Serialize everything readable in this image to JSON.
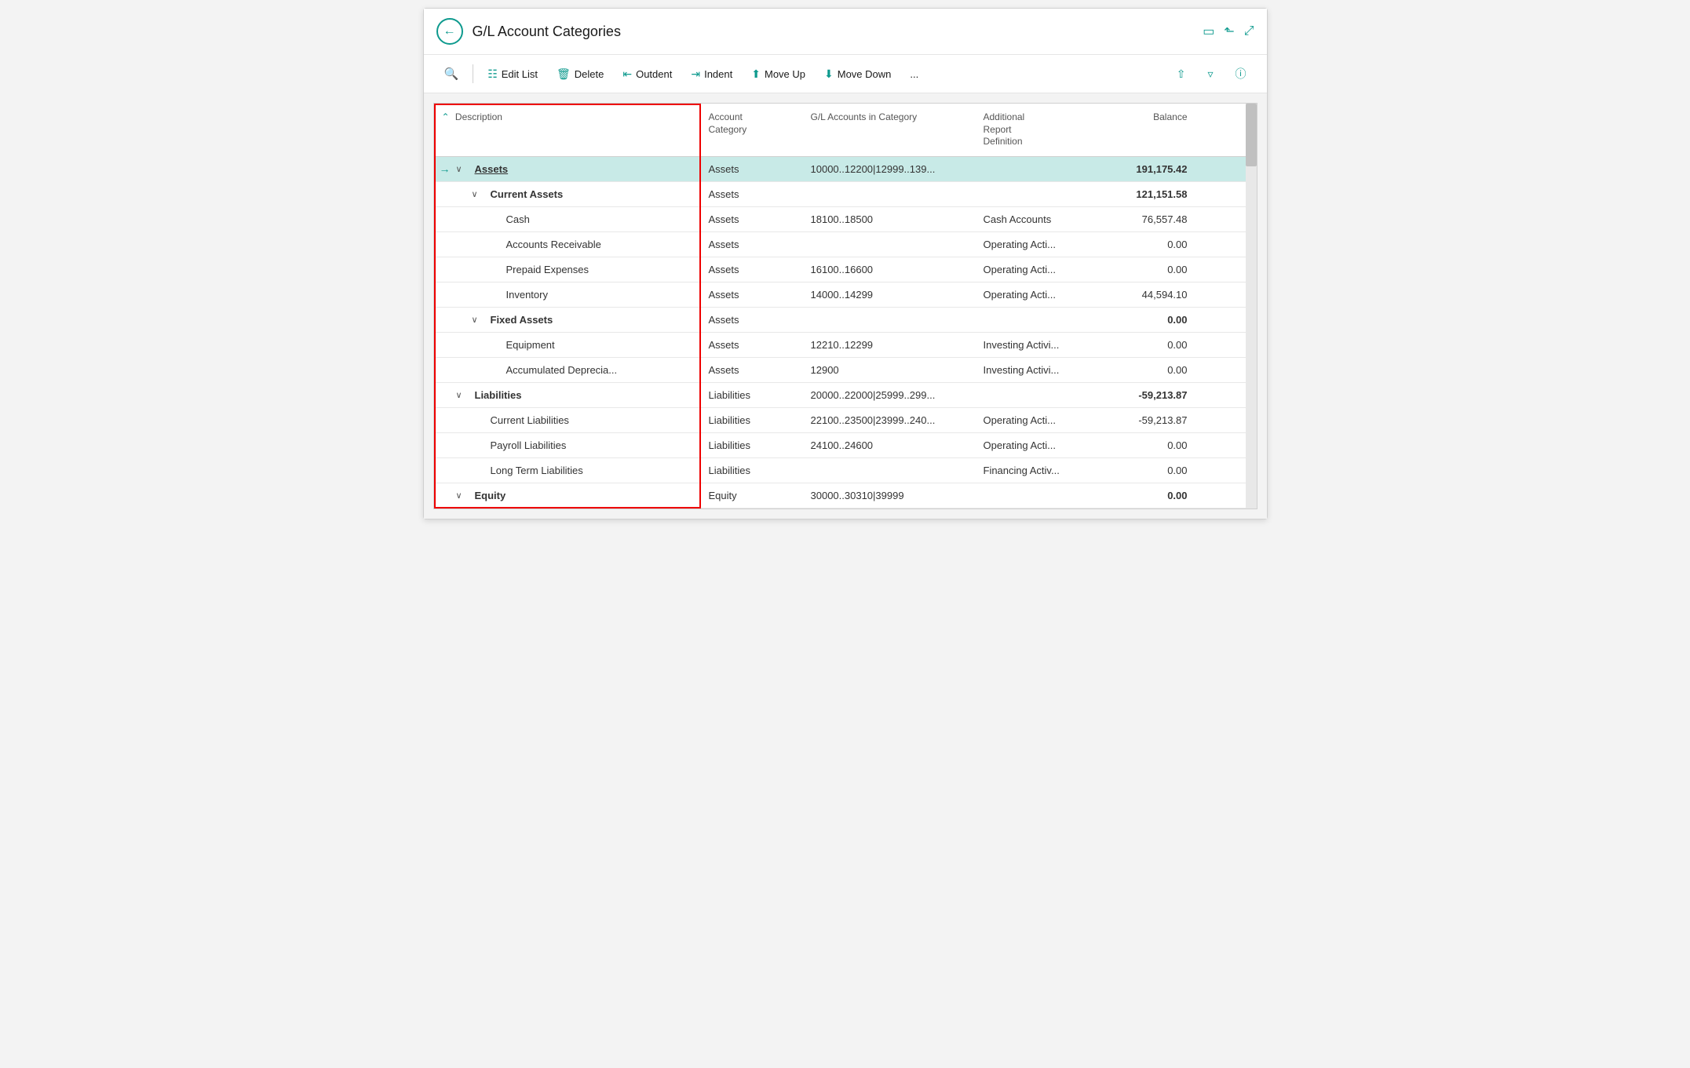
{
  "window": {
    "title": "G/L Account Categories"
  },
  "toolbar": {
    "search_placeholder": "Search",
    "edit_list": "Edit List",
    "delete": "Delete",
    "outdent": "Outdent",
    "indent": "Indent",
    "move_up": "Move Up",
    "move_down": "Move Down",
    "more": "...",
    "share_icon": "↑",
    "filter_icon": "⊿",
    "info_icon": "ⓘ"
  },
  "table": {
    "columns": [
      {
        "label": "Description"
      },
      {
        "label": "Account\nCategory"
      },
      {
        "label": "G/L Accounts in Category"
      },
      {
        "label": "Additional\nReport\nDefinition"
      },
      {
        "label": "Balance",
        "align": "right"
      }
    ],
    "rows": [
      {
        "indent": 0,
        "has_chevron": true,
        "chevron_dir": "down",
        "description": "Assets",
        "desc_bold": true,
        "desc_underline": true,
        "has_drag": true,
        "account_category": "Assets",
        "gl_accounts": "10000..12200|12999..139...",
        "add_report": "",
        "balance": "191,175.42",
        "balance_bold": true,
        "selected": true,
        "has_arrow": true
      },
      {
        "indent": 1,
        "has_chevron": true,
        "chevron_dir": "down",
        "description": "Current Assets",
        "desc_bold": true,
        "account_category": "Assets",
        "gl_accounts": "",
        "add_report": "",
        "balance": "121,151.58",
        "balance_bold": true,
        "selected": false
      },
      {
        "indent": 2,
        "has_chevron": false,
        "description": "Cash",
        "desc_bold": false,
        "account_category": "Assets",
        "gl_accounts": "18100..18500",
        "add_report": "Cash Accounts",
        "balance": "76,557.48",
        "balance_bold": false,
        "selected": false
      },
      {
        "indent": 2,
        "has_chevron": false,
        "description": "Accounts Receivable",
        "desc_bold": false,
        "account_category": "Assets",
        "gl_accounts": "",
        "add_report": "Operating Acti...",
        "balance": "0.00",
        "balance_bold": false,
        "selected": false
      },
      {
        "indent": 2,
        "has_chevron": false,
        "description": "Prepaid Expenses",
        "desc_bold": false,
        "account_category": "Assets",
        "gl_accounts": "16100..16600",
        "add_report": "Operating Acti...",
        "balance": "0.00",
        "balance_bold": false,
        "selected": false
      },
      {
        "indent": 2,
        "has_chevron": false,
        "description": "Inventory",
        "desc_bold": false,
        "account_category": "Assets",
        "gl_accounts": "14000..14299",
        "add_report": "Operating Acti...",
        "balance": "44,594.10",
        "balance_bold": false,
        "selected": false
      },
      {
        "indent": 1,
        "has_chevron": true,
        "chevron_dir": "down",
        "description": "Fixed Assets",
        "desc_bold": true,
        "account_category": "Assets",
        "gl_accounts": "",
        "add_report": "",
        "balance": "0.00",
        "balance_bold": true,
        "selected": false
      },
      {
        "indent": 2,
        "has_chevron": false,
        "description": "Equipment",
        "desc_bold": false,
        "account_category": "Assets",
        "gl_accounts": "12210..12299",
        "add_report": "Investing Activi...",
        "balance": "0.00",
        "balance_bold": false,
        "selected": false
      },
      {
        "indent": 2,
        "has_chevron": false,
        "description": "Accumulated Deprecia...",
        "desc_bold": false,
        "account_category": "Assets",
        "gl_accounts": "12900",
        "add_report": "Investing Activi...",
        "balance": "0.00",
        "balance_bold": false,
        "selected": false
      },
      {
        "indent": 0,
        "has_chevron": true,
        "chevron_dir": "down",
        "description": "Liabilities",
        "desc_bold": true,
        "account_category": "Liabilities",
        "gl_accounts": "20000..22000|25999..299...",
        "add_report": "",
        "balance": "-59,213.87",
        "balance_bold": true,
        "balance_negative": true,
        "selected": false
      },
      {
        "indent": 1,
        "has_chevron": false,
        "description": "Current Liabilities",
        "desc_bold": false,
        "account_category": "Liabilities",
        "gl_accounts": "22100..23500|23999..240...",
        "add_report": "Operating Acti...",
        "balance": "-59,213.87",
        "balance_bold": false,
        "balance_negative": true,
        "selected": false
      },
      {
        "indent": 1,
        "has_chevron": false,
        "description": "Payroll Liabilities",
        "desc_bold": false,
        "account_category": "Liabilities",
        "gl_accounts": "24100..24600",
        "add_report": "Operating Acti...",
        "balance": "0.00",
        "balance_bold": false,
        "selected": false
      },
      {
        "indent": 1,
        "has_chevron": false,
        "description": "Long Term Liabilities",
        "desc_bold": false,
        "account_category": "Liabilities",
        "gl_accounts": "",
        "add_report": "Financing Activ...",
        "balance": "0.00",
        "balance_bold": false,
        "selected": false
      },
      {
        "indent": 0,
        "has_chevron": true,
        "chevron_dir": "down",
        "description": "Equity",
        "desc_bold": true,
        "account_category": "Equity",
        "gl_accounts": "30000..30310|39999",
        "add_report": "",
        "balance": "0.00",
        "balance_bold": true,
        "selected": false
      }
    ]
  }
}
